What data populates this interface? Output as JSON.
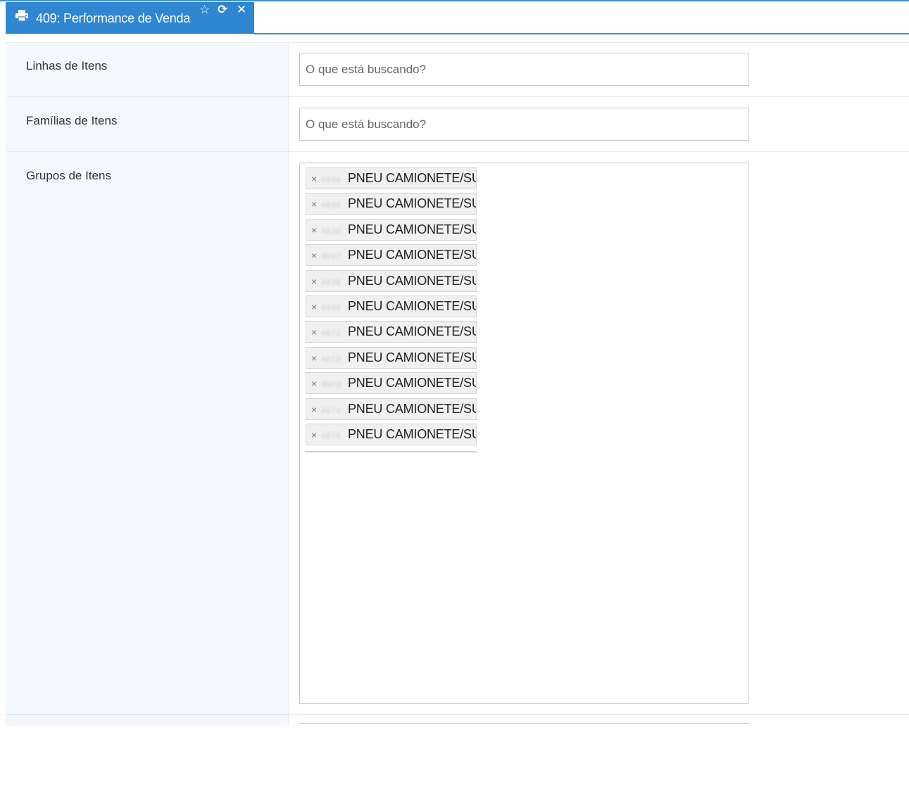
{
  "tab": {
    "icon": "printer-icon",
    "title": "409: Performance de Venda",
    "favorite_glyph": "☆",
    "refresh_glyph": "⟳",
    "close_glyph": "✕"
  },
  "form": {
    "linhas": {
      "label": "Linhas de Itens",
      "placeholder": "O que está buscando?"
    },
    "familias": {
      "label": "Famílias de Itens",
      "placeholder": "O que está buscando?"
    },
    "grupos": {
      "label": "Grupos de Itens",
      "remove_glyph": "×",
      "tags": [
        {
          "code": "4634",
          "name": "PNEU CAMIONETE/SUV"
        },
        {
          "code": "4635",
          "name": "PNEU CAMIONETE/SUV"
        },
        {
          "code": "4636",
          "name": "PNEU CAMIONETE/SUV"
        },
        {
          "code": "4637",
          "name": "PNEU CAMIONETE/SUV"
        },
        {
          "code": "4638",
          "name": "PNEU CAMIONETE/SUV"
        },
        {
          "code": "4639",
          "name": "PNEU CAMIONETE/SUV"
        },
        {
          "code": "4671",
          "name": "PNEU CAMIONETE/SUV"
        },
        {
          "code": "4672",
          "name": "PNEU CAMIONETE/SUV"
        },
        {
          "code": "4673",
          "name": "PNEU CAMIONETE/SUV"
        },
        {
          "code": "4674",
          "name": "PNEU CAMIONETE/SUV"
        },
        {
          "code": "4675",
          "name": "PNEU CAMIONETE/SUV"
        }
      ]
    }
  },
  "colors": {
    "accent": "#2f86d1",
    "label_panel": "#f4f8fd"
  }
}
